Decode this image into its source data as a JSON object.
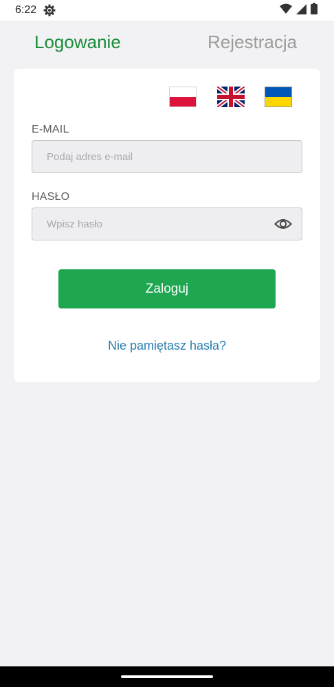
{
  "status_bar": {
    "time": "6:22",
    "icons": [
      "settings-icon",
      "wifi-icon",
      "signal-icon",
      "battery-icon"
    ]
  },
  "tabs": {
    "login": "Logowanie",
    "register": "Rejestracja",
    "active": "login"
  },
  "languages": [
    {
      "code": "pl",
      "icon": "poland-flag-icon"
    },
    {
      "code": "en",
      "icon": "uk-flag-icon"
    },
    {
      "code": "uk",
      "icon": "ukraine-flag-icon"
    }
  ],
  "form": {
    "email_label": "E-MAIL",
    "email_placeholder": "Podaj adres e-mail",
    "email_value": "",
    "password_label": "HASŁO",
    "password_placeholder": "Wpisz hasło",
    "password_value": "",
    "login_button": "Zaloguj",
    "forgot_link": "Nie pamiętasz hasła?"
  },
  "colors": {
    "accent": "#1a8d3b",
    "button": "#1ea650",
    "link": "#2a7fb0",
    "inactive_tab": "#9c9c9c",
    "background": "#f2f1f4"
  }
}
